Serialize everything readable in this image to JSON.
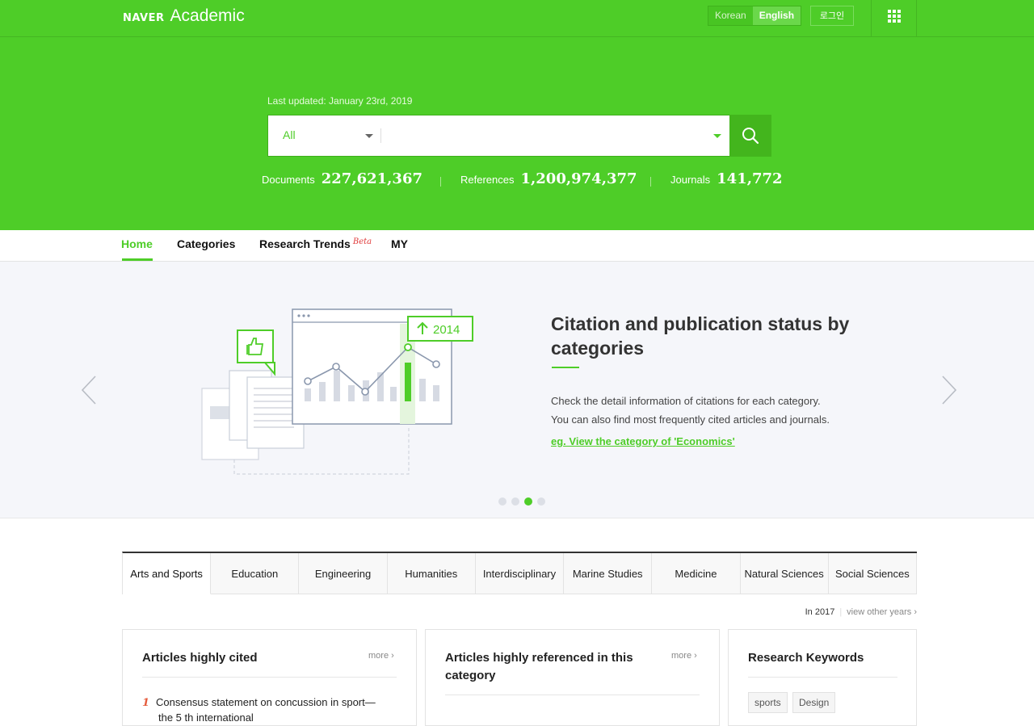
{
  "brand": {
    "naver": "NAVER",
    "academic": "Academic"
  },
  "topbar": {
    "lang_korean": "Korean",
    "lang_english": "English",
    "login": "로그인",
    "apps_icon": "grid-apps-icon"
  },
  "search": {
    "last_updated": "Last updated: January 23rd, 2019",
    "scope": "All",
    "query": "",
    "button_icon": "search-icon"
  },
  "stats": [
    {
      "label": "Documents",
      "value": "227,621,367"
    },
    {
      "label": "References",
      "value": "1,200,974,377"
    },
    {
      "label": "Journals",
      "value": "141,772"
    }
  ],
  "nav": {
    "home": "Home",
    "categories": "Categories",
    "research_trends": "Research Trends",
    "beta": "Beta",
    "my": "MY"
  },
  "slide": {
    "badge_year": "2014",
    "title": "Citation and publication status by categories",
    "desc_1": "Check the detail information of citations for each category.",
    "desc_2": "You can also find most frequently cited articles and journals.",
    "link": "eg. View the category of 'Economics'",
    "active_dot": 3,
    "total_dots": 4
  },
  "categories": [
    "Arts and Sports",
    "Education",
    "Engineering",
    "Humanities",
    "Interdisciplinary",
    "Marine Studies",
    "Medicine",
    "Natural Sciences",
    "Social Sciences"
  ],
  "year_row": {
    "year": "In 2017",
    "other": "view other years"
  },
  "panels": {
    "cited": {
      "title": "Articles highly cited",
      "more": "more",
      "item_1_num": "1",
      "item_1_text": "Consensus statement on concussion in sport—",
      "item_1_text2": "the 5 th international"
    },
    "referenced": {
      "title": "Articles highly referenced in this category",
      "more": "more"
    },
    "keywords": {
      "title": "Research Keywords",
      "tags": [
        "sports",
        "Design"
      ]
    }
  },
  "colors": {
    "brand_green": "#4ecd28",
    "dark_green": "#43b51d"
  }
}
